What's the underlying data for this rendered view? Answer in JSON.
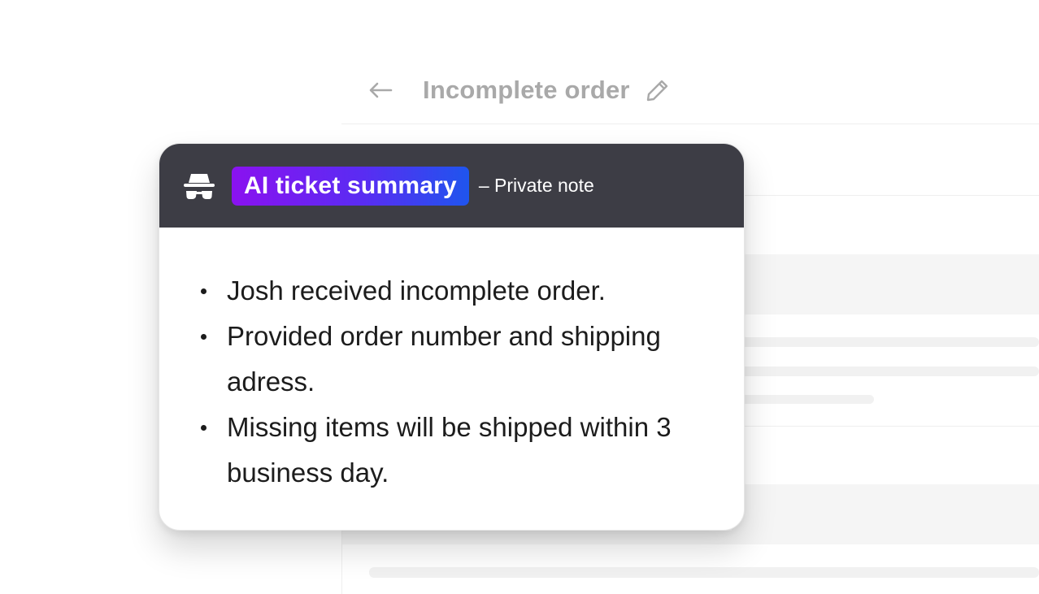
{
  "ticket": {
    "title": "Incomplete order",
    "icons": {
      "back": "arrow-left-icon",
      "edit": "pencil-icon"
    }
  },
  "summary_card": {
    "icon": "spy-icon",
    "badge_label": "AI ticket summary",
    "note_label": "– Private note",
    "bullets": [
      "Josh received incomplete order.",
      "Provided order number and shipping adress.",
      "Missing items will be shipped within 3 business day."
    ]
  },
  "colors": {
    "card_header": "#3d3d45",
    "badge_gradient_start": "#8a12f0",
    "badge_gradient_end": "#1f55ee",
    "muted_text": "#a9a9a9"
  }
}
